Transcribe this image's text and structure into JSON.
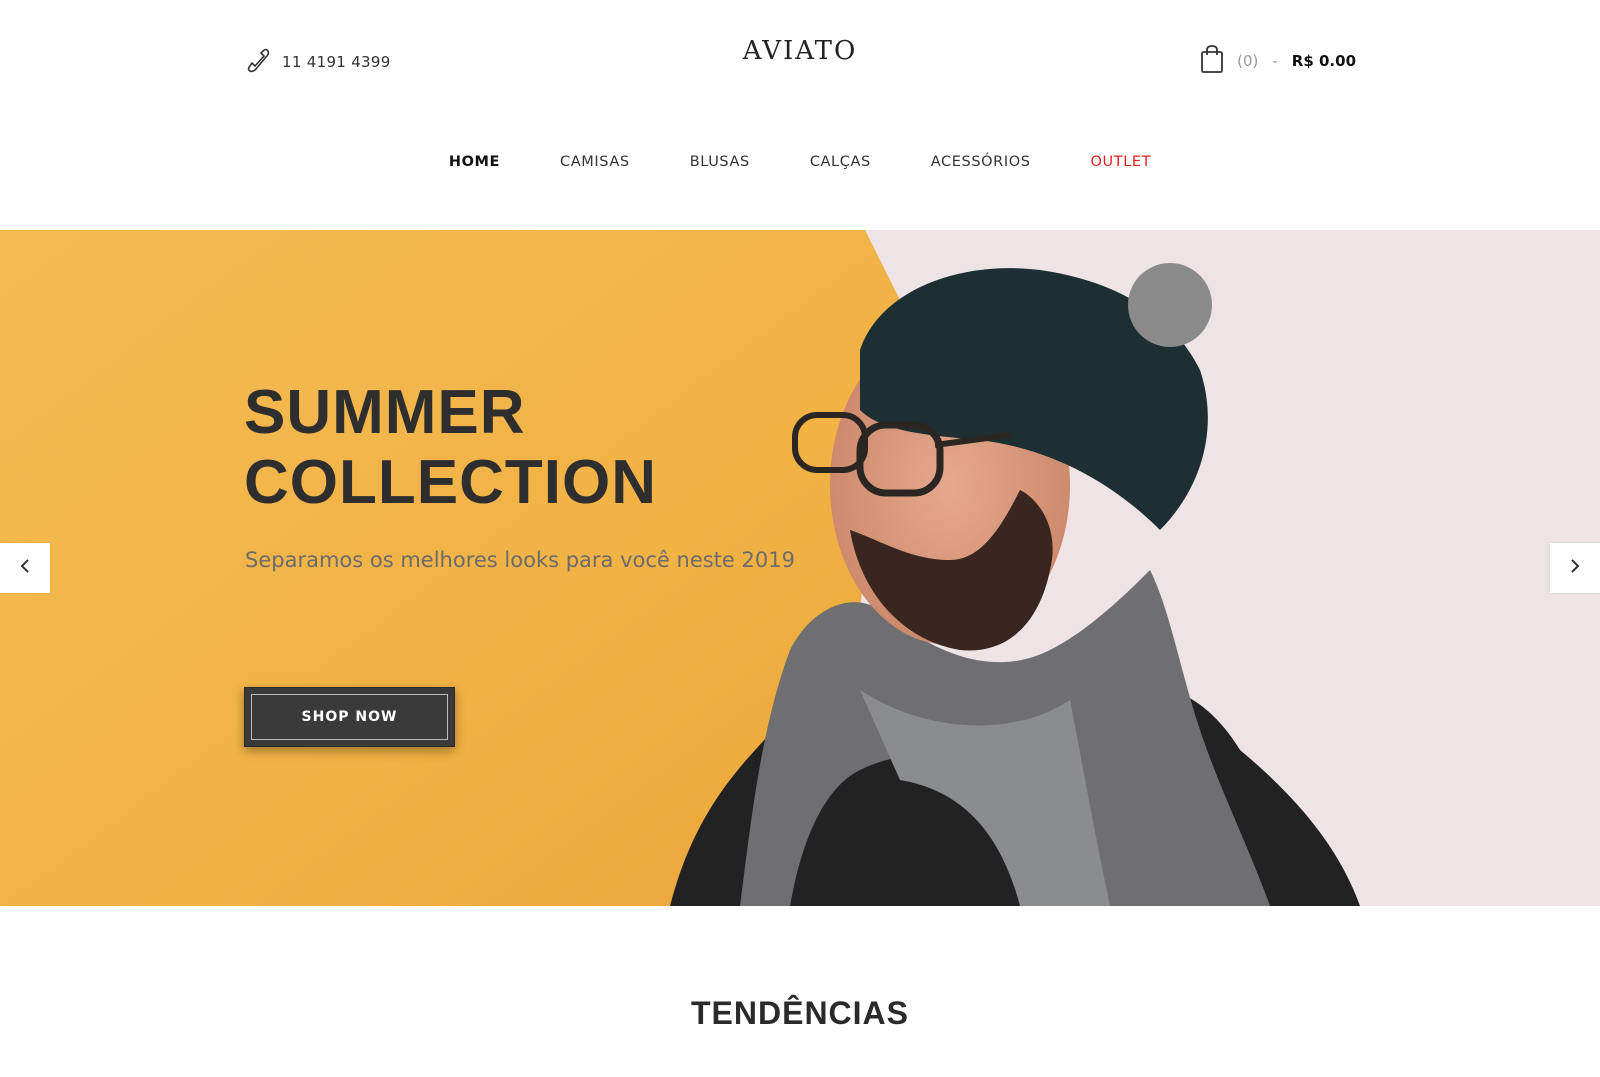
{
  "header": {
    "phone": "11 4191 4399",
    "logo": "AVIATO",
    "cart": {
      "count": "(0)",
      "separator": "-",
      "total": "R$ 0.00"
    }
  },
  "nav": {
    "items": [
      {
        "label": "HOME"
      },
      {
        "label": "CAMISAS"
      },
      {
        "label": "BLUSAS"
      },
      {
        "label": "CALÇAS"
      },
      {
        "label": "ACESSÓRIOS"
      },
      {
        "label": "OUTLET"
      }
    ],
    "active": "HOME",
    "highlight_color": "#e02020"
  },
  "hero": {
    "headline_line1": "SUMMER",
    "headline_line2": "COLLECTION",
    "subtitle": "Separamos os melhores looks para você neste 2019",
    "button_label": "SHOP NOW",
    "colors": {
      "wall_yellow": "#f2b545",
      "wall_white": "#efe6e7",
      "button_bg": "#3a3a3a"
    }
  },
  "section": {
    "title": "TENDÊNCIAS"
  },
  "icons": {
    "phone": "phone-icon",
    "cart": "shopping-bag-icon",
    "prev": "chevron-left-icon",
    "next": "chevron-right-icon"
  }
}
